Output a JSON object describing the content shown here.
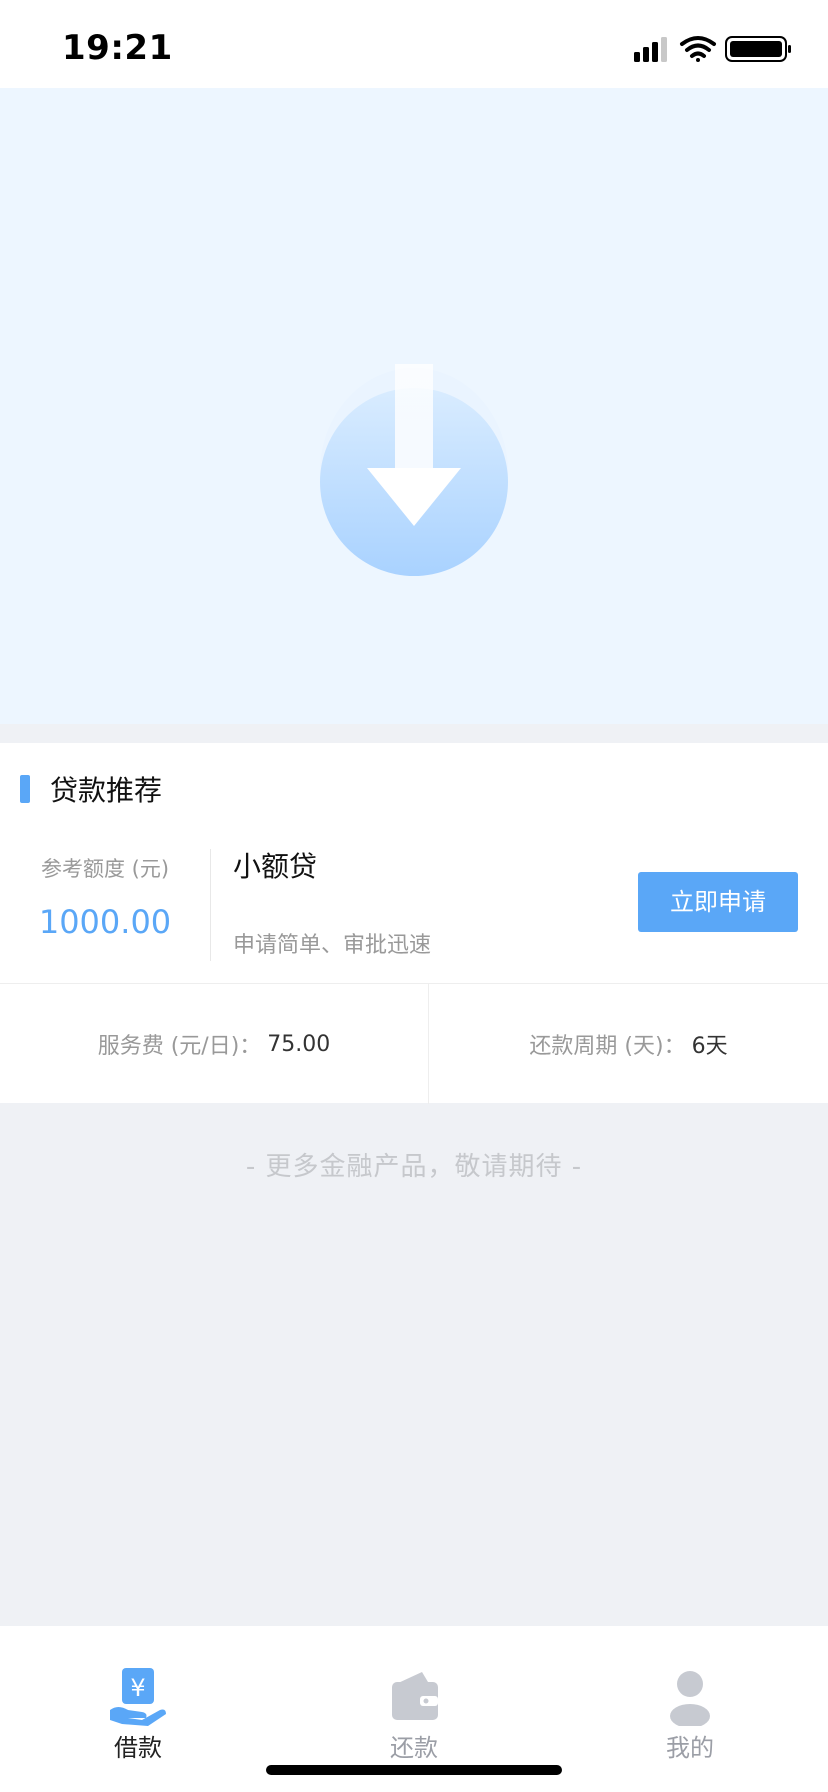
{
  "status_bar": {
    "time": "19:21"
  },
  "section": {
    "title": "贷款推荐"
  },
  "product": {
    "limit_label": "参考额度 (元)",
    "limit_value": "1000.00",
    "name": "小额贷",
    "description": "申请简单、审批迅速",
    "apply_label": "立即申请"
  },
  "info": {
    "fee_label": "服务费 (元/日)：",
    "fee_value": "75.00",
    "cycle_label": "还款周期 (天)：",
    "cycle_value": "6天"
  },
  "footer_note": "- 更多金融产品，敬请期待 -",
  "tabs": [
    {
      "label": "借款",
      "icon": "yen-hand-icon",
      "active": true
    },
    {
      "label": "还款",
      "icon": "wallet-icon",
      "active": false
    },
    {
      "label": "我的",
      "icon": "user-icon",
      "active": false
    }
  ],
  "colors": {
    "accent": "#5aa7f7",
    "banner_bg": "#edf6ff",
    "page_bg": "#eff1f5",
    "inactive_tab": "#9b9ea6"
  }
}
